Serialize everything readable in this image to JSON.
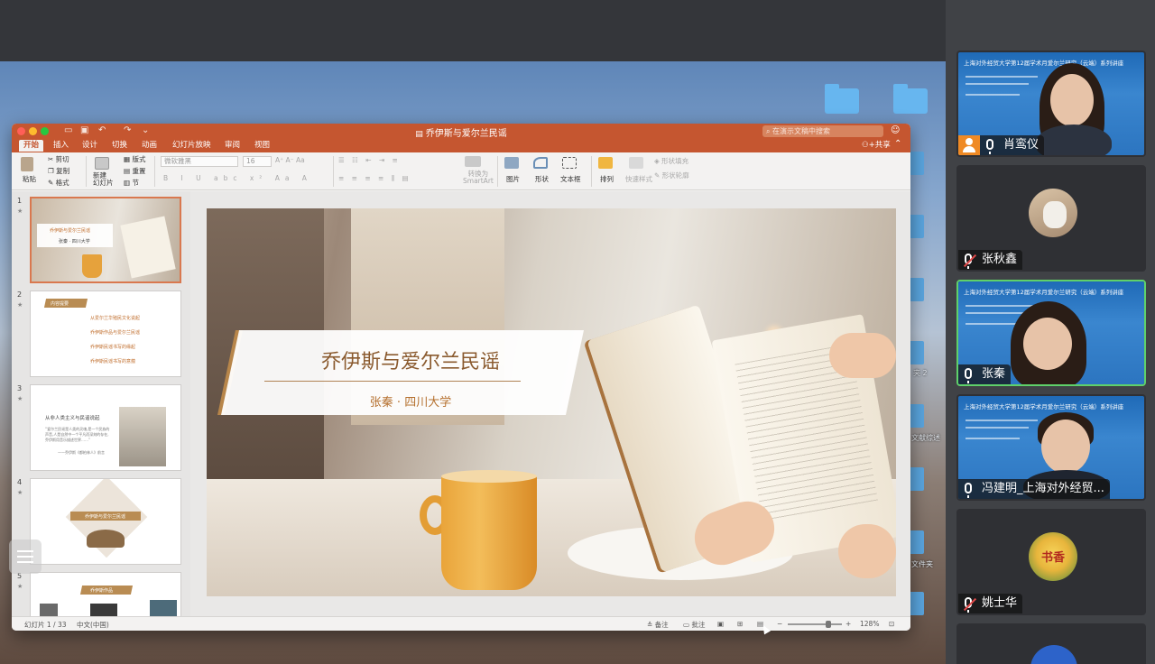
{
  "ppt": {
    "title": "乔伊斯与爱尔兰民谣",
    "search_placeholder": "在演示文稿中搜索",
    "tabs": [
      "开始",
      "插入",
      "设计",
      "切换",
      "动画",
      "幻灯片放映",
      "审阅",
      "视图"
    ],
    "active_tab": "开始",
    "share_label": "共享",
    "ribbon": {
      "paste": "粘贴",
      "cut": "剪切",
      "copy": "复制",
      "format": "格式",
      "new_slide": "新建\n幻灯片",
      "layout": "版式",
      "reset": "重置",
      "section": "节",
      "font_name": "微软雅黑",
      "font_size": "16",
      "convert_smartart": "转换为\nSmartArt",
      "picture": "图片",
      "shape": "形状",
      "textbox": "文本框",
      "arrange": "排列",
      "quick_styles": "快速样式",
      "shape_fill": "形状填充",
      "shape_outline": "形状轮廓"
    },
    "thumbnails": [
      {
        "num": "1",
        "title": "乔伊斯与爱尔兰民谣",
        "sub": "张秦 · 四川大学"
      },
      {
        "num": "2",
        "heading": "内容提要",
        "items": [
          "从爱尔兰华殖民文化说起",
          "乔伊斯作品与爱尔兰民谣",
          "乔伊斯民谣书写的缘起",
          "乔伊斯民谣书写的意蕴"
        ]
      },
      {
        "num": "3",
        "heading": "从非人类主义与民谣说起",
        "body": "“爱尔兰民谣是人类的灵魂,是一个民族的声音,人是自然中一个平凡而深刻的存在,乔伊斯用音乐描述世界……”",
        "cite": "——乔伊斯《都柏林人》前言"
      },
      {
        "num": "4",
        "heading": "乔伊斯与爱尔兰民谣"
      },
      {
        "num": "5",
        "heading": "乔伊斯作品"
      }
    ],
    "slide": {
      "title": "乔伊斯与爱尔兰民谣",
      "subtitle": "张秦 · 四川大学"
    },
    "status": {
      "slide_counter": "幻灯片 1 / 33",
      "language": "中文(中国)",
      "notes": "备注",
      "comments": "批注",
      "zoom": "128%",
      "zoom_fraction": 0.75
    }
  },
  "desktop": {
    "labels": [
      "夹 2",
      "文献综述",
      "文件夹"
    ]
  },
  "participants": [
    {
      "name": "肖鸾仪",
      "muted": false,
      "host": true,
      "video": "poster",
      "poster_title": "上海对外经贸大学第12届学术月爱尔兰研究（云端）系列讲座"
    },
    {
      "name": "张秋鑫",
      "muted": true,
      "host": false,
      "video": "avatar"
    },
    {
      "name": "张秦",
      "muted": false,
      "host": false,
      "video": "poster",
      "active": true,
      "poster_title": "上海对外经贸大学第12届学术月爱尔兰研究（云端）系列讲座"
    },
    {
      "name": "冯建明_上海对外经贸...",
      "muted": false,
      "host": false,
      "video": "poster",
      "poster_title": "上海对外经贸大学第12届学术月爱尔兰研究（云端）系列讲座"
    },
    {
      "name": "姚士华",
      "muted": true,
      "host": false,
      "video": "avatar",
      "avatar_text": "书香"
    }
  ],
  "colors": {
    "ppt_accent": "#c55630",
    "active_speaker": "#5fd16a",
    "host_badge": "#ef8a25",
    "slide_title": "#8a5a2e"
  }
}
